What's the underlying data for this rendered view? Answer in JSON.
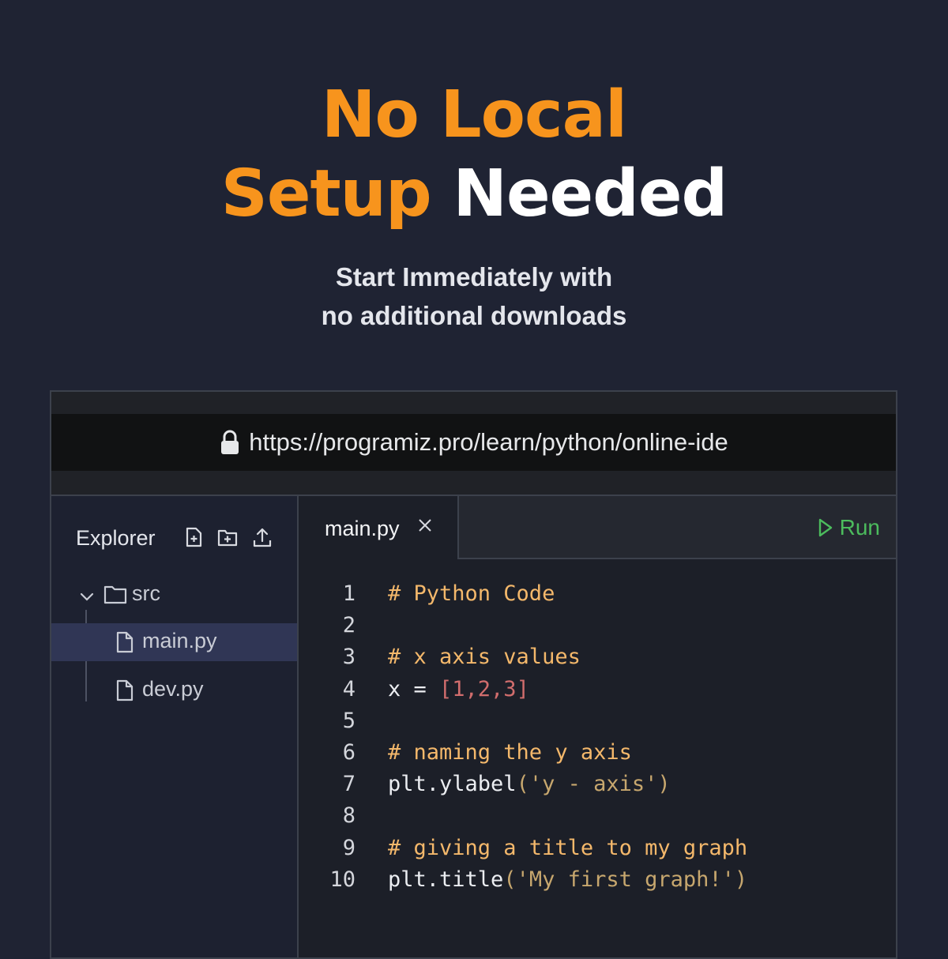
{
  "hero": {
    "line1": "No Local",
    "line2_orange": "Setup",
    "line2_white": "Needed",
    "sub1": "Start Immediately with",
    "sub2": "no additional downloads"
  },
  "browser": {
    "url": "https://programiz.pro/learn/python/online-ide"
  },
  "sidebar": {
    "title": "Explorer",
    "icons": [
      "new-file-icon",
      "new-folder-icon",
      "upload-icon"
    ],
    "folder": "src",
    "files": [
      "main.py",
      "dev.py"
    ],
    "active_file": "main.py"
  },
  "editor": {
    "tab_label": "main.py",
    "run_label": "Run",
    "lines": [
      {
        "n": "1",
        "parts": [
          {
            "t": "# Python Code",
            "k": "comment"
          }
        ]
      },
      {
        "n": "2",
        "parts": []
      },
      {
        "n": "3",
        "parts": [
          {
            "t": "# x axis values",
            "k": "comment"
          }
        ]
      },
      {
        "n": "4",
        "parts": [
          {
            "t": "x = ",
            "k": "plain"
          },
          {
            "t": "[1,2,3]",
            "k": "num"
          }
        ]
      },
      {
        "n": "5",
        "parts": []
      },
      {
        "n": "6",
        "parts": [
          {
            "t": "# naming the y axis",
            "k": "comment"
          }
        ]
      },
      {
        "n": "7",
        "parts": [
          {
            "t": "plt.ylabel",
            "k": "plain"
          },
          {
            "t": "('y - axis')",
            "k": "str"
          }
        ]
      },
      {
        "n": "8",
        "parts": []
      },
      {
        "n": "9",
        "parts": [
          {
            "t": "# giving a title to my graph",
            "k": "comment"
          }
        ]
      },
      {
        "n": "10",
        "parts": [
          {
            "t": "plt.title",
            "k": "plain"
          },
          {
            "t": "('My first graph!')",
            "k": "str"
          }
        ]
      }
    ]
  },
  "colors": {
    "accent_orange": "#f7941d",
    "run_green": "#4cbc5d",
    "background": "#1f2333"
  }
}
